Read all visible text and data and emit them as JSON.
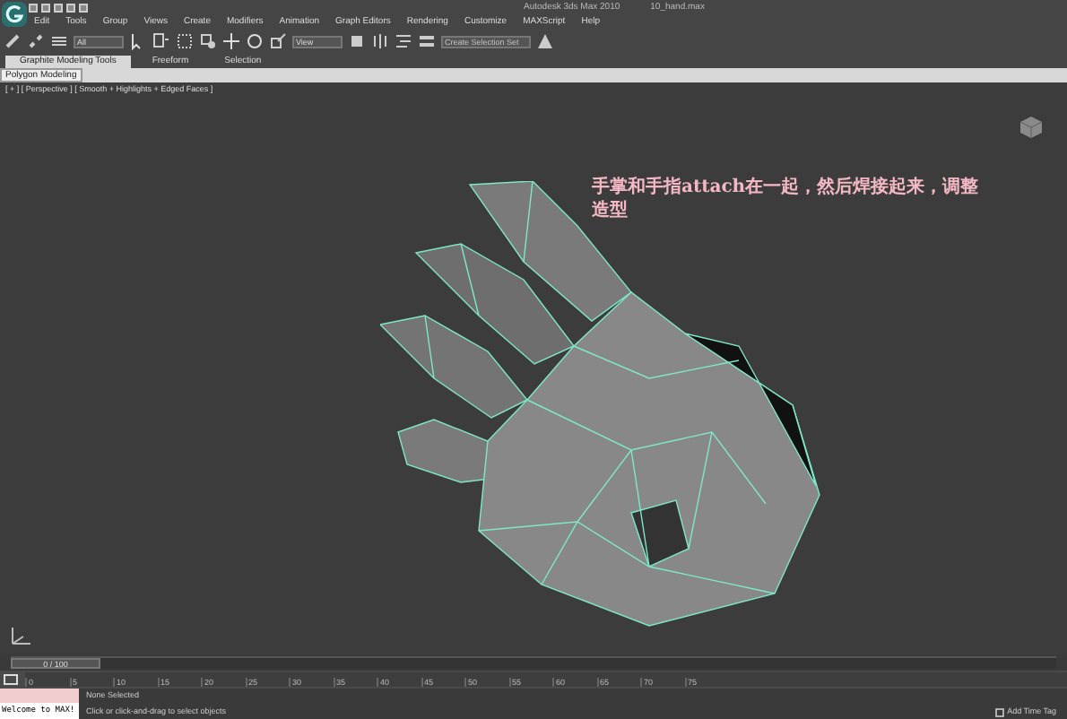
{
  "window": {
    "title": "Autodesk 3ds Max 2010",
    "file": "10_hand.max"
  },
  "menu": [
    "Edit",
    "Tools",
    "Group",
    "Views",
    "Create",
    "Modifiers",
    "Animation",
    "Graph Editors",
    "Rendering",
    "Customize",
    "MAXScript",
    "Help"
  ],
  "toolbar": {
    "selection_filter": "All",
    "reference_coordinate": "View",
    "named_selection_placeholder": "Create Selection Set"
  },
  "ribbon": {
    "tabs": [
      {
        "label": "Graphite Modeling Tools",
        "selected": true
      },
      {
        "label": "Freeform",
        "selected": false
      },
      {
        "label": "Selection",
        "selected": false
      }
    ],
    "panel": "Polygon Modeling"
  },
  "viewport": {
    "label": "[ + ] [ Perspective ] [ Smooth + Highlights + Edged Faces ]",
    "annotation": [
      "手掌和手指attach在一起，然后焊接起来，调整",
      "造型"
    ]
  },
  "timeline": {
    "slider": "0 / 100",
    "level": 0,
    "ticks": [
      "0",
      "5",
      "10",
      "15",
      "20",
      "25",
      "30",
      "35",
      "40",
      "45",
      "50",
      "55",
      "60",
      "65",
      "70",
      "75"
    ]
  },
  "status_bar": {
    "maxscript": "Welcome to MAX!",
    "selection": "None Selected",
    "prompt": "Click or click-and-drag to select objects",
    "time_tag": "Add Time Tag"
  }
}
